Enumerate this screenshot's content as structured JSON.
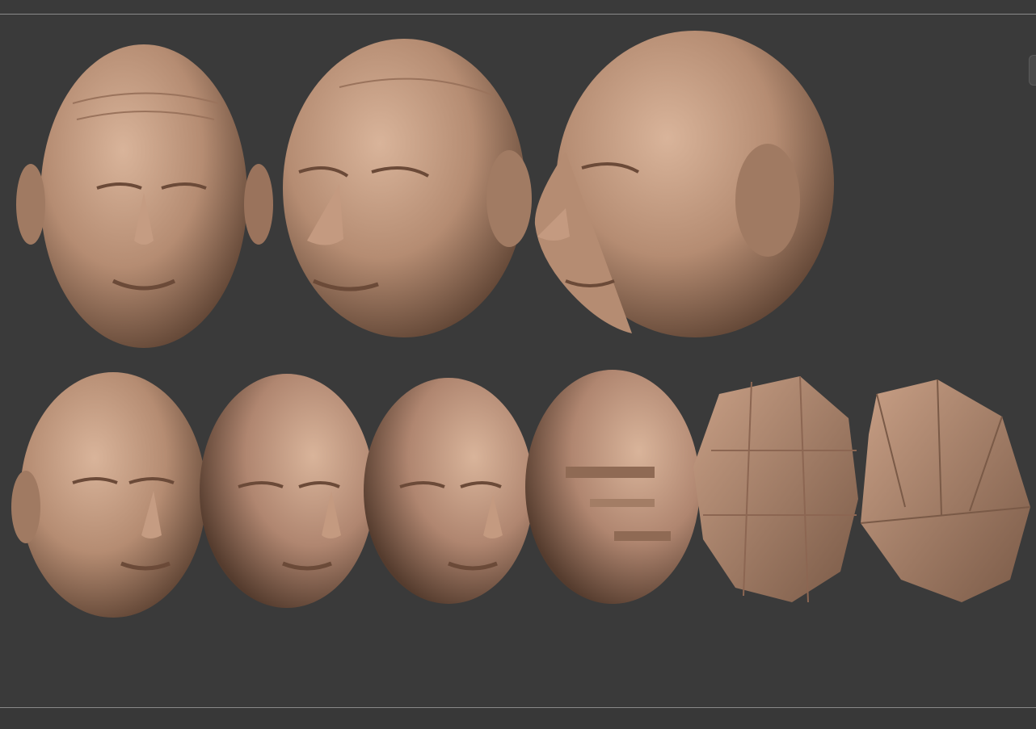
{
  "app": {
    "accent_color": "#3a3a3a",
    "rule_color": "#8a8a8a"
  },
  "viewport": {
    "material_color": "#b58c72",
    "rows": [
      {
        "name": "row-views",
        "models": [
          "head-front-view",
          "head-three-quarter-view",
          "head-profile-view"
        ]
      },
      {
        "name": "row-subdivision-levels",
        "models": [
          "head-subdiv-level-6",
          "head-subdiv-level-5",
          "head-subdiv-level-4",
          "head-subdiv-level-3",
          "head-subdiv-level-2",
          "head-subdiv-level-1"
        ]
      }
    ]
  }
}
